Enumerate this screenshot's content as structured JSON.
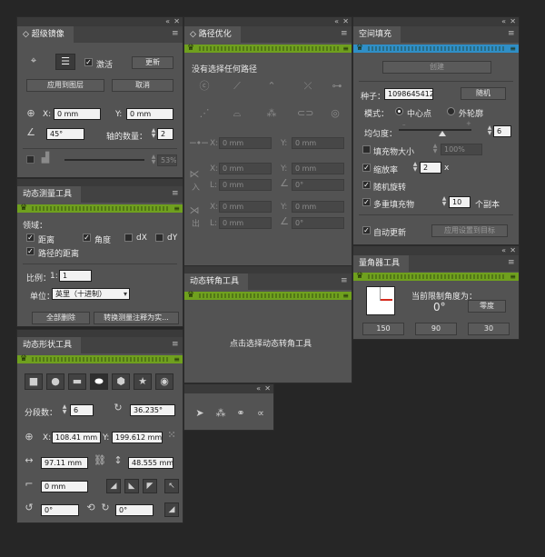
{
  "controls": {
    "collapse": "«",
    "close": "✕",
    "menu": "≡",
    "crown": "♛"
  },
  "super_mirror": {
    "title": "超级镜像",
    "realtime_label": "激活",
    "update_btn": "更新",
    "apply_btn": "应用到图层",
    "cancel_btn": "取消",
    "x_label": "X:",
    "x_value": "0 mm",
    "y_label": "Y:",
    "y_value": "0 mm",
    "angle_value": "45°",
    "axis_count_label": "轴的数量：",
    "axis_count_value": "2",
    "percent_value": "53%"
  },
  "path_optimize": {
    "title": "路径优化",
    "status": "没有选择任何路径",
    "fields": [
      {
        "label": "X:",
        "value": "0 mm"
      },
      {
        "label": "Y:",
        "value": "0 mm"
      },
      {
        "label": "X:",
        "value": "0 mm"
      },
      {
        "label": "Y:",
        "value": "0 mm"
      },
      {
        "label": "L:",
        "value": "0 mm"
      },
      {
        "label": "",
        "value": "0°"
      },
      {
        "label": "X:",
        "value": "0 mm"
      },
      {
        "label": "Y:",
        "value": "0 mm"
      },
      {
        "label": "L:",
        "value": "0 mm"
      },
      {
        "label": "",
        "value": "0°"
      }
    ],
    "in_label": "入",
    "out_label": "出"
  },
  "space_fill": {
    "title": "空间填充",
    "create_btn": "创建",
    "seed_label": "种子：",
    "seed_value": "1098645412",
    "random_btn": "随机",
    "mode_label": "模式：",
    "mode_center": "中心点",
    "mode_outer": "外轮廓",
    "uniformity_label": "均匀度：",
    "uniformity_value": "6",
    "fill_size_label": "填充物大小",
    "fill_size_value": "100%",
    "scale_label": "缩放率",
    "scale_value": "2",
    "scale_unit": "x",
    "random_rotate_label": "随机旋转",
    "multi_fill_label": "多重填充物",
    "copies_value": "10",
    "copies_unit": "个副本",
    "auto_update_label": "自动更新",
    "apply_target_btn": "应用设置到目标"
  },
  "dyn_measure": {
    "title": "动态测量工具",
    "domain_label": "领域：",
    "options": [
      "距离",
      "角度",
      "dX",
      "dY"
    ],
    "path_distance": "路径的距离",
    "ratio_label": "比例：",
    "ratio_prefix": "1:",
    "ratio_value": "1",
    "unit_label": "单位：",
    "unit_value": "英里（十进制）",
    "delete_all_btn": "全部删除",
    "convert_btn": "转换测量注释为实..."
  },
  "dyn_corner": {
    "title": "动态转角工具",
    "hint": "点击选择动态转角工具"
  },
  "bisector": {
    "title": "量角器工具",
    "current_label": "当前限制角度为：",
    "angle_value": "0°",
    "zero_btn": "零度",
    "presets": [
      "150",
      "90",
      "30"
    ]
  },
  "dyn_shape": {
    "title": "动态形状工具",
    "segments_label": "分段数：",
    "segments_value": "6",
    "rotation_value": "36.235°",
    "x_label": "X:",
    "x_value": "108.41 mm",
    "y_label": "Y:",
    "y_value": "199.612 mm",
    "width_value": "97.11 mm",
    "height_value": "48.555 mm",
    "corner_value": "0 mm",
    "angle1_value": "0°",
    "angle2_value": "0°"
  }
}
